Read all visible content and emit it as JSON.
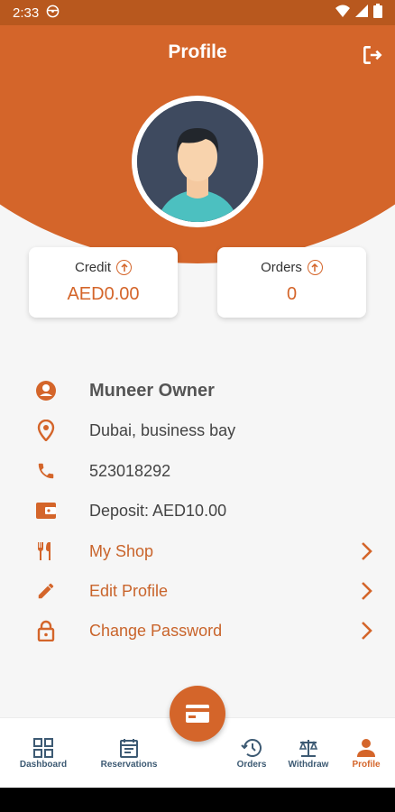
{
  "status_bar": {
    "time": "2:33"
  },
  "header": {
    "title": "Profile"
  },
  "cards": {
    "credit": {
      "label": "Credit",
      "value": "AED0.00"
    },
    "orders": {
      "label": "Orders",
      "value": "0"
    }
  },
  "info": {
    "name": "Muneer Owner",
    "location": "Dubai, business bay",
    "phone": "523018292",
    "deposit": "Deposit:  AED10.00",
    "my_shop": "My Shop",
    "edit_profile": "Edit Profile",
    "change_password": "Change Password"
  },
  "nav": {
    "dashboard": "Dashboard",
    "reservations": "Reservations",
    "orders": "Orders",
    "withdraw": "Withdraw",
    "profile": "Profile"
  },
  "colors": {
    "accent": "#d4652a",
    "status_bar": "#b8581e",
    "nav_text": "#3d5a73"
  },
  "icons": [
    "wifi-icon",
    "signal-icon",
    "battery-icon",
    "logout-icon",
    "user-icon",
    "location-icon",
    "phone-icon",
    "wallet-icon",
    "shop-icon",
    "edit-icon",
    "lock-icon",
    "chevron-right-icon",
    "dashboard-icon",
    "calendar-icon",
    "history-icon",
    "scale-icon",
    "person-icon",
    "card-icon"
  ]
}
